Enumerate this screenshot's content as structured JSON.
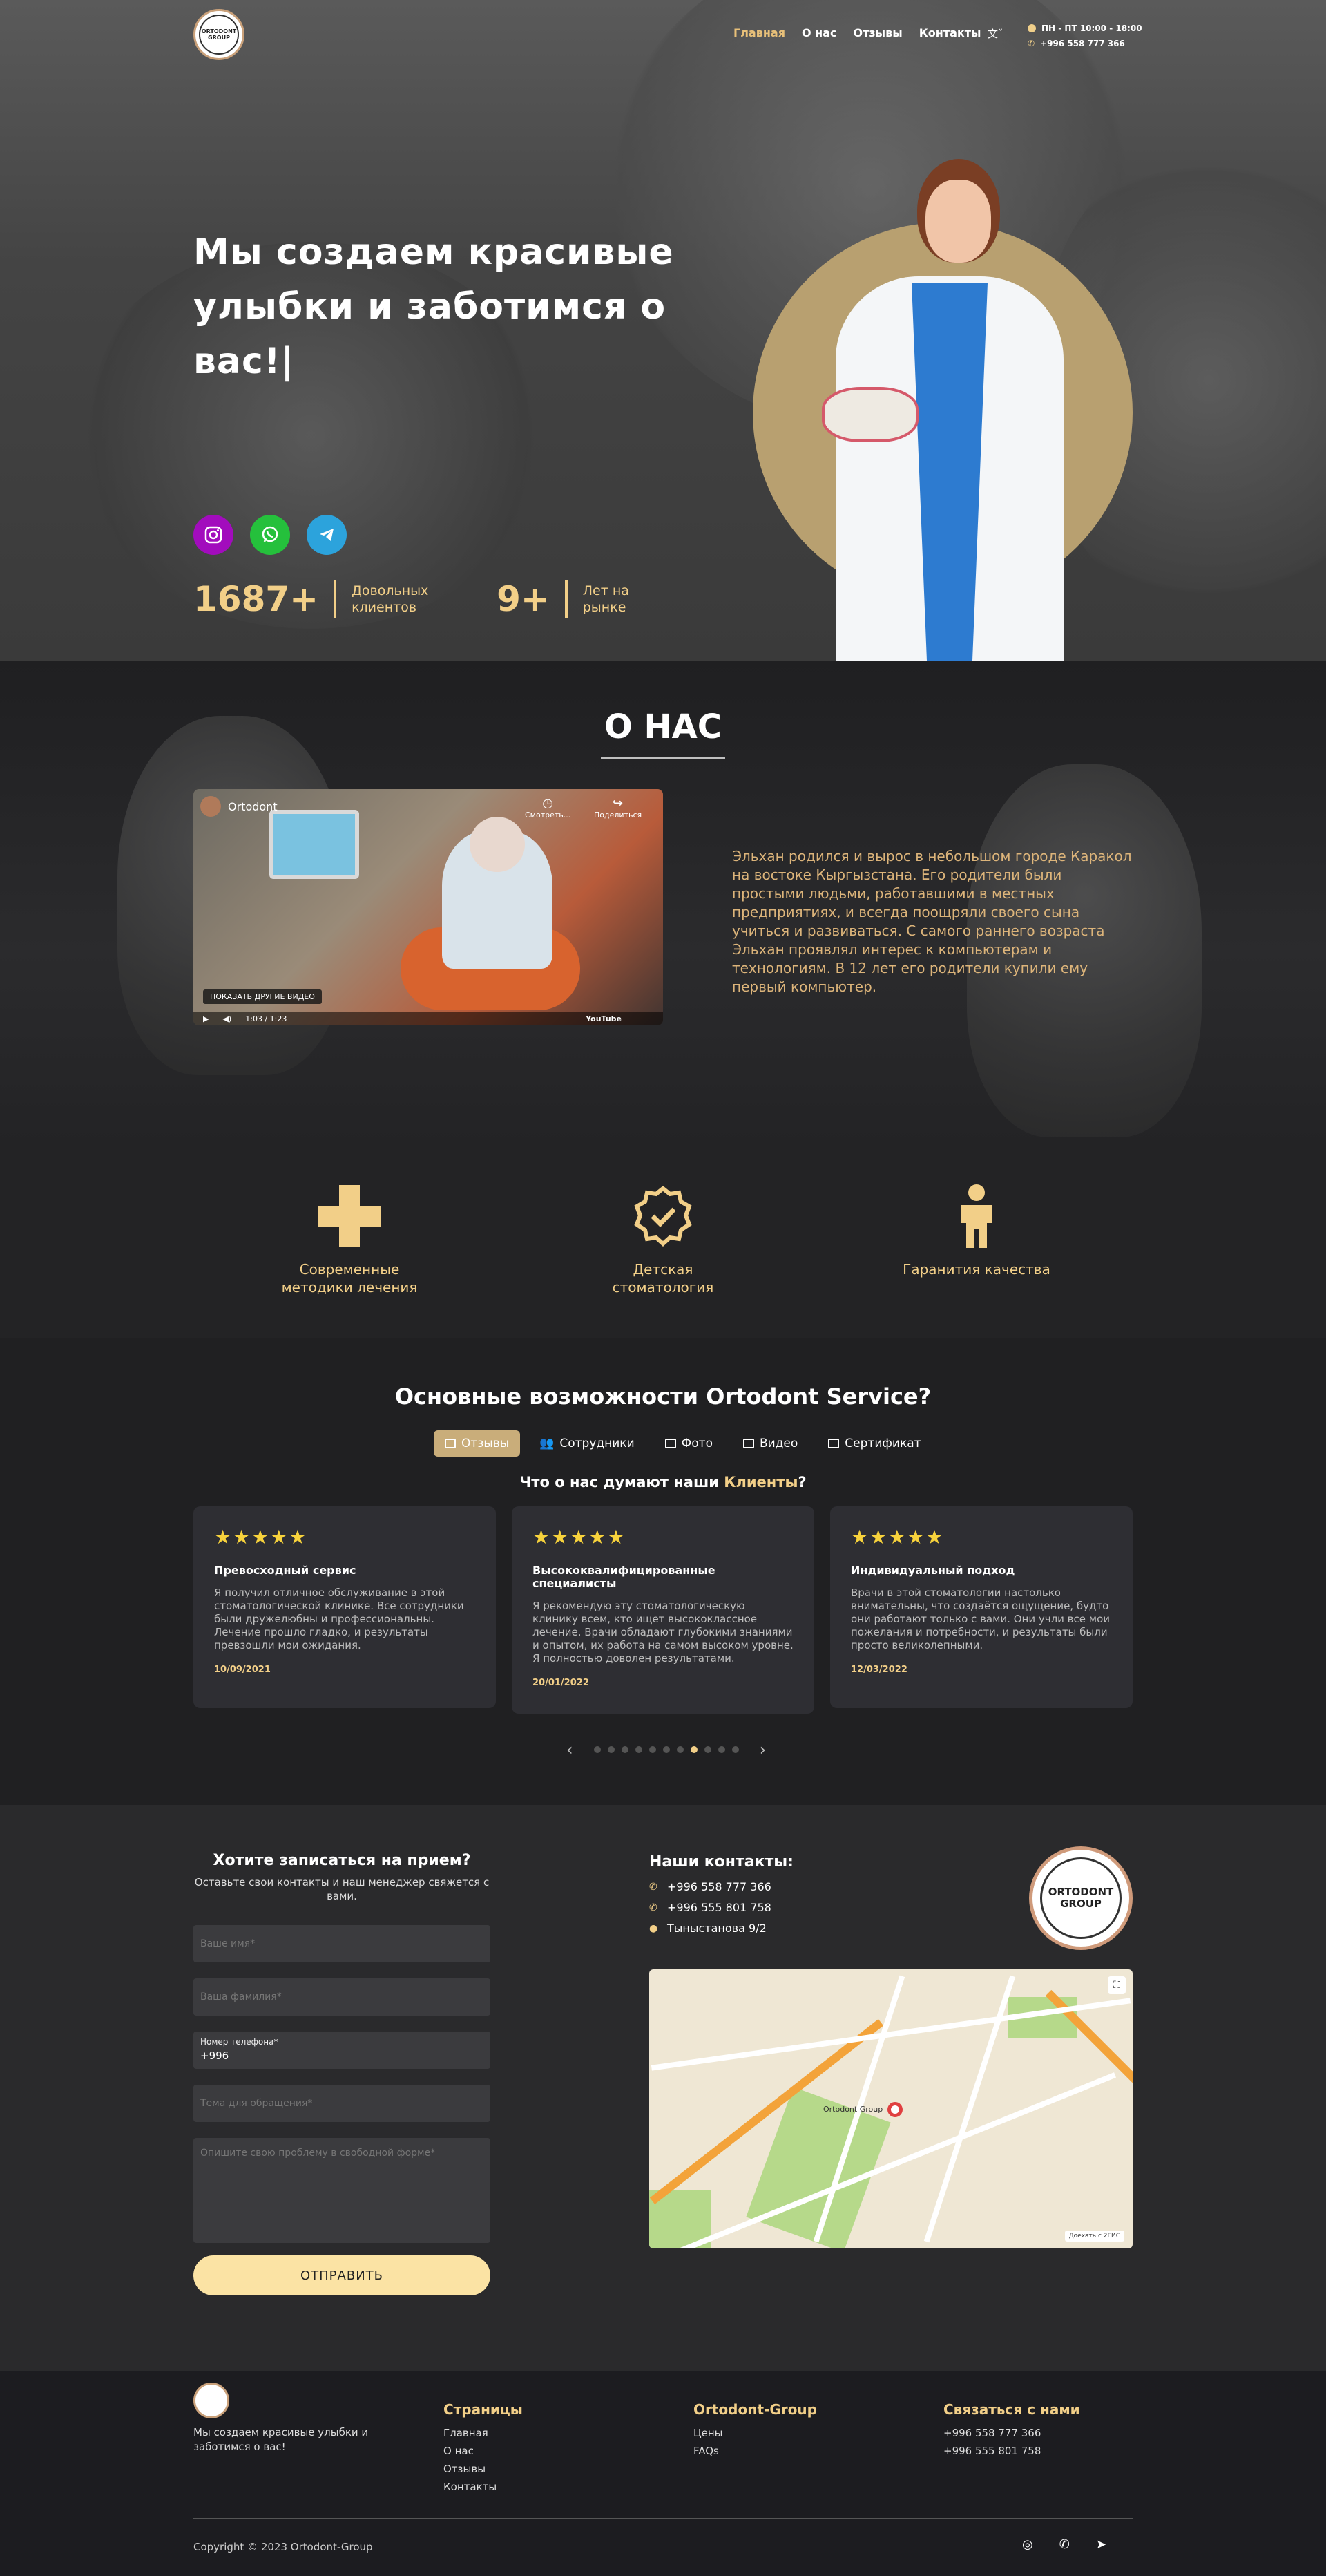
{
  "nav": {
    "logo_text": "ORTODONT GROUP",
    "items": [
      {
        "label": "Главная"
      },
      {
        "label": "О нас"
      },
      {
        "label": "Отзывы"
      },
      {
        "label": "Контакты"
      }
    ],
    "hours": "ПН - ПТ 10:00 - 18:00",
    "phone": "+996 558 777 366"
  },
  "hero": {
    "headline": "Мы создаем красивые улыбки и заботимся о вас!|",
    "stats": [
      {
        "value": "1687+",
        "label": "Довольных клиентов"
      },
      {
        "value": "9+",
        "label": "Лет на рынке"
      }
    ]
  },
  "about": {
    "title": "О НАС",
    "video": {
      "channel": "Ortodont",
      "watch_later": "Смотреть...",
      "share": "Поделиться",
      "more_videos": "ПОКАЗАТЬ ДРУГИЕ ВИДЕО",
      "time": "1:03 / 1:23",
      "platform": "YouTube"
    },
    "text": "Эльхан родился и вырос в небольшом городе Каракол на востоке Кыргызстана. Его родители были простыми людьми, работавшими в местных предприятиях, и всегда поощряли своего сына учиться и развиваться. С самого раннего возраста Эльхан проявлял интерес к компьютерам и технологиям. В 12 лет его родители купили ему первый компьютер."
  },
  "features": [
    {
      "label": "Современные методики лечения"
    },
    {
      "label": "Детская стоматология"
    },
    {
      "label": "Гаранития качества"
    }
  ],
  "service": {
    "title": "Основные возможности Ortodont Service?",
    "tabs": [
      {
        "label": "Отзывы"
      },
      {
        "label": "Сотрудники"
      },
      {
        "label": "Фото"
      },
      {
        "label": "Видео"
      },
      {
        "label": "Сертификат"
      }
    ],
    "subtitle_prefix": "Что о нас думают наши",
    "subtitle_accent": "Клиенты",
    "subtitle_suffix": "?",
    "reviews": [
      {
        "stars": "★★★★★",
        "title": "Превосходный сервис",
        "text": "Я получил отличное обслуживание в этой стоматологической клинике. Все сотрудники были дружелюбны и профессиональны. Лечение прошло гладко, и результаты превзошли мои ожидания.",
        "date": "10/09/2021"
      },
      {
        "stars": "★★★★★",
        "title": "Высококвалифицированные специалисты",
        "text": "Я рекомендую эту стоматологическую клинику всем, кто ищет высококлассное лечение. Врачи обладают глубокими знаниями и опытом, их работа на самом высоком уровне. Я полностью доволен результатами.",
        "date": "20/01/2022"
      },
      {
        "stars": "★★★★★",
        "title": "Индивидуальный подход",
        "text": "Врачи в этой стоматологии настолько внимательны, что создаётся ощущение, будто они работают только с вами. Они учли все мои пожелания и потребности, и результаты были просто великолепными.",
        "date": "12/03/2022"
      }
    ],
    "prev": "‹",
    "next": "›"
  },
  "contact": {
    "form_title": "Хотите записаться на прием?",
    "form_sub": "Оставьте свои контакты и наш менеджер свяжется с вами.",
    "first_name_ph": "Ваше имя*",
    "last_name_ph": "Ваша фамилия*",
    "phone_label": "Номер телефона*",
    "phone_value": "+996",
    "topic_ph": "Тема для обращения*",
    "problem_ph": "Опишите свою проблему в свободной форме*",
    "submit": "ОТПРАВИТЬ",
    "contacts_title": "Наши контакты:",
    "phones": [
      "+996 558 777 366",
      "+996 555 801 758"
    ],
    "address": "Тыныстанова 9/2",
    "logo_line1": "ORTODONT",
    "logo_line2": "GROUP",
    "map_label": "Ortodont Group",
    "map_attr": "Доехать с 2ГИС"
  },
  "footer": {
    "tagline": "Мы создаем красивые улыбки и заботимся о вас!",
    "pages_title": "Страницы",
    "pages": [
      "Главная",
      "О нас",
      "Отзывы",
      "Контакты"
    ],
    "group_title": "Ortodont-Group",
    "group": [
      "Цены",
      "FAQs"
    ],
    "contact_title": "Связаться с нами",
    "contact": [
      "+996 558 777 366",
      "+996 555 801 758"
    ],
    "copyright": "Copyright © 2023 Ortodont-Group"
  }
}
